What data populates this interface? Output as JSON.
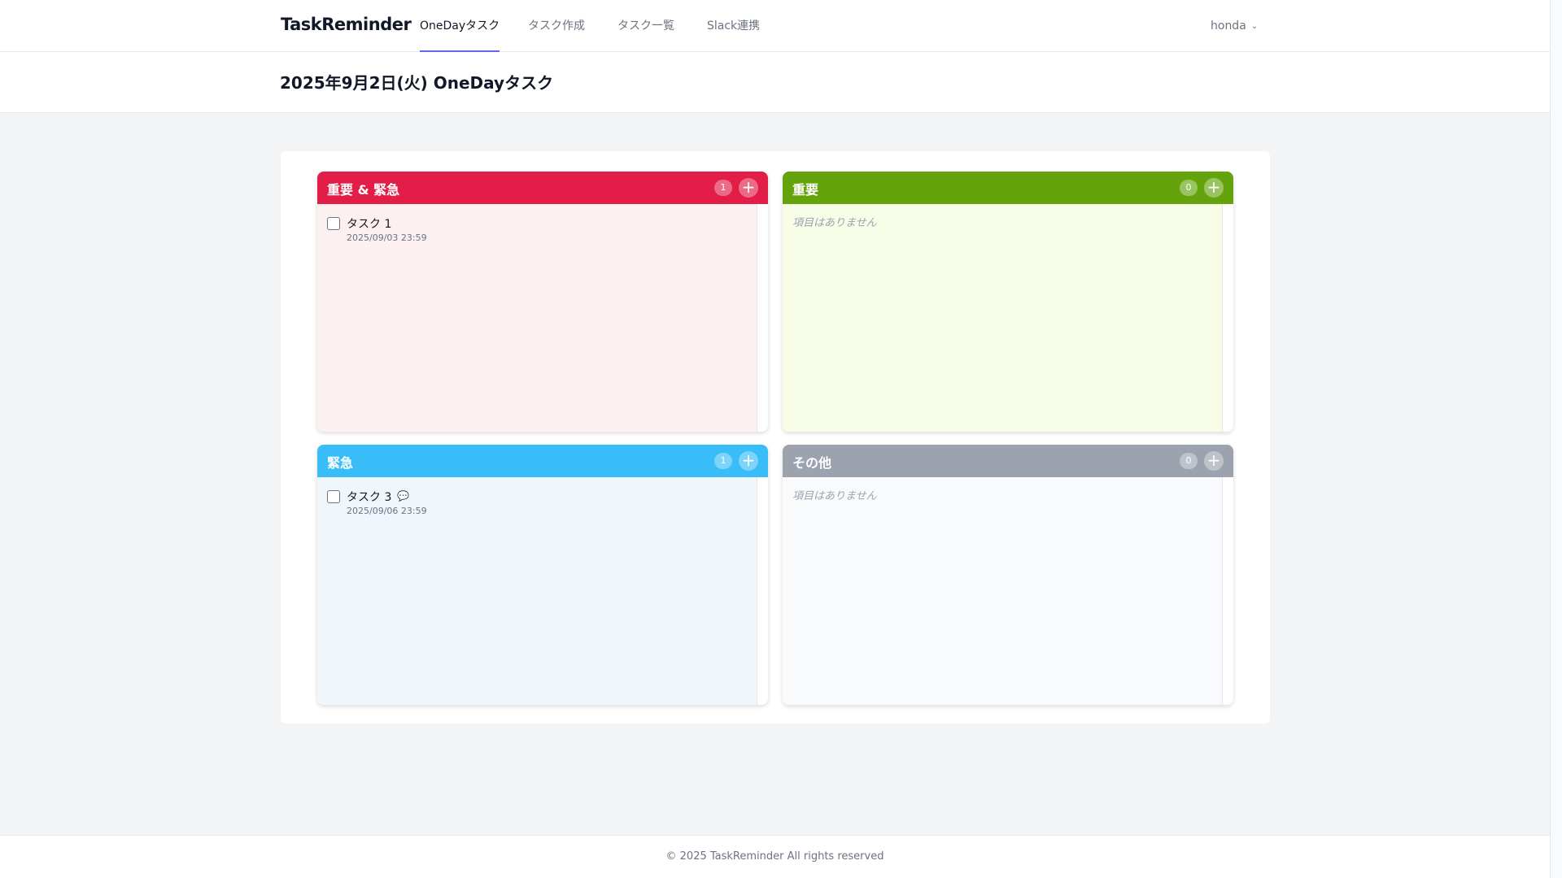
{
  "nav": {
    "brand": "TaskReminder",
    "links": [
      "OneDayタスク",
      "タスク作成",
      "タスク一覧",
      "Slack連携"
    ],
    "user": "honda",
    "accent": "#6366f1"
  },
  "page": {
    "title": "2025年9月2日(火) OneDayタスク"
  },
  "quadrants": [
    {
      "title": "重要 & 緊急",
      "count": "1",
      "header_color": "#e11d48",
      "body_color": "#fdf0f0",
      "tasks": [
        {
          "name": "タスク 1",
          "due": "2025/09/03 23:59"
        }
      ]
    },
    {
      "title": "重要",
      "count": "0",
      "header_color": "#65a30d",
      "body_color": "#f7fde7",
      "empty_text": "項目はありません"
    },
    {
      "title": "緊急",
      "count": "1",
      "header_color": "#38bdf8",
      "body_color": "#eff7fd",
      "tasks": [
        {
          "name": "タスク 3",
          "due": "2025/09/06 23:59",
          "comment_icon": "comment-icon"
        }
      ]
    },
    {
      "title": "その他",
      "count": "0",
      "header_color": "#9ca3af",
      "body_color": "#f8fafc",
      "empty_text": "項目はありません"
    }
  ],
  "footer": {
    "text": "©  2025  TaskReminder  All rights reserved"
  }
}
